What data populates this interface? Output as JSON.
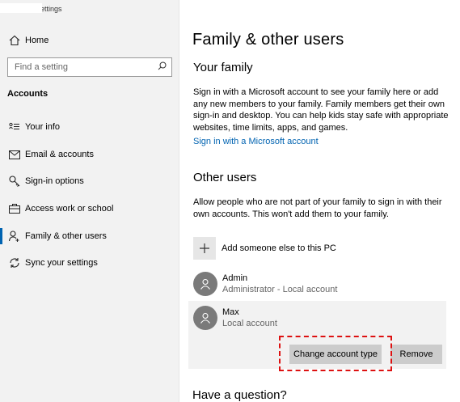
{
  "window": {
    "title": "Settings"
  },
  "sidebar": {
    "home_label": "Home",
    "search_placeholder": "Find a setting",
    "section_title": "Accounts",
    "items": [
      {
        "label": "Your info",
        "icon": "contact-card-icon",
        "active": false
      },
      {
        "label": "Email & accounts",
        "icon": "mail-icon",
        "active": false
      },
      {
        "label": "Sign-in options",
        "icon": "key-icon",
        "active": false
      },
      {
        "label": "Access work or school",
        "icon": "briefcase-icon",
        "active": false
      },
      {
        "label": "Family & other users",
        "icon": "person-add-icon",
        "active": true
      },
      {
        "label": "Sync your settings",
        "icon": "sync-icon",
        "active": false
      }
    ]
  },
  "main": {
    "title": "Family & other users",
    "your_family": {
      "heading": "Your family",
      "description": "Sign in with a Microsoft account to see your family here or add any new members to your family. Family members get their own sign-in and desktop. You can help kids stay safe with appropriate websites, time limits, apps, and games.",
      "link": "Sign in with a Microsoft account"
    },
    "other_users": {
      "heading": "Other users",
      "description": "Allow people who are not part of your family to sign in with their own accounts. This won't add them to your family.",
      "add_label": "Add someone else to this PC",
      "users": [
        {
          "name": "Admin",
          "role": "Administrator - Local account"
        },
        {
          "name": "Max",
          "role": "Local account"
        }
      ],
      "change_button": "Change account type",
      "remove_button": "Remove"
    },
    "question_heading": "Have a question?"
  },
  "colors": {
    "accent": "#0063b1",
    "highlight": "#dd1111",
    "sidebar_bg": "#f2f2f2"
  }
}
